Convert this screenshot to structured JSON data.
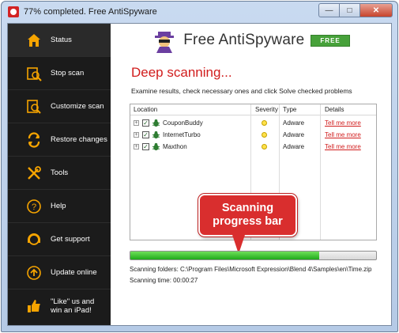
{
  "window": {
    "title": "77% completed. Free AntiSpyware"
  },
  "sidebar": {
    "items": [
      {
        "label": "Status",
        "icon": "home-icon"
      },
      {
        "label": "Stop scan",
        "icon": "stop-scan-icon"
      },
      {
        "label": "Customize scan",
        "icon": "customize-scan-icon"
      },
      {
        "label": "Restore changes",
        "icon": "restore-icon"
      },
      {
        "label": "Tools",
        "icon": "tools-icon"
      },
      {
        "label": "Help",
        "icon": "help-icon"
      },
      {
        "label": "Get support",
        "icon": "support-icon"
      },
      {
        "label": "Update online",
        "icon": "update-icon"
      },
      {
        "label": "\"Like\" us and",
        "label2": "win an iPad!",
        "icon": "thumbs-up-icon"
      }
    ]
  },
  "header": {
    "brand": "Free AntiSpyware",
    "badge": "FREE"
  },
  "main": {
    "title": "Deep scanning...",
    "instructions": "Examine results, check necessary ones and click Solve checked problems",
    "columns": [
      "Location",
      "Severity",
      "Type",
      "Details"
    ],
    "rows": [
      {
        "name": "CouponBuddy",
        "type": "Adware",
        "details": "Tell me more",
        "checked": true
      },
      {
        "name": "InternetTurbo",
        "type": "Adware",
        "details": "Tell me more",
        "checked": true
      },
      {
        "name": "Maxthon",
        "type": "Adware",
        "details": "Tell me more",
        "checked": true
      }
    ],
    "callout": {
      "line1": "Scanning",
      "line2": "progress bar"
    },
    "progress": 0.77,
    "scan_folders": "Scanning folders: C:\\Program Files\\Microsoft Expression\\Blend 4\\Samples\\en\\Time.zip",
    "scan_time": "Scanning time: 00:00:27"
  },
  "colors": {
    "accent_red": "#d11d1d",
    "badge_green": "#47a13a",
    "progress_green": "#1faa1a",
    "sidebar_bg": "#1b1b1b",
    "sidebar_icon": "#f6a400"
  }
}
